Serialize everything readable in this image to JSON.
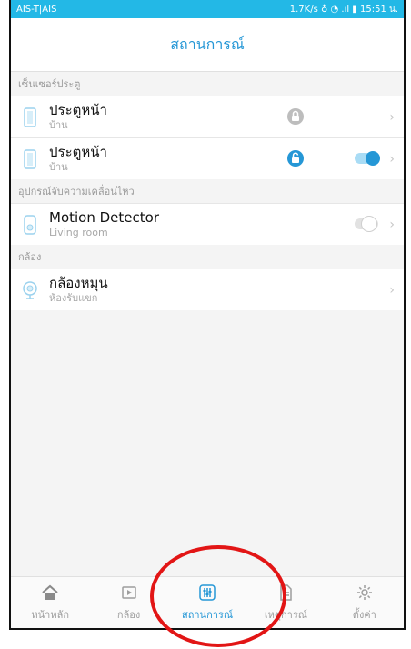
{
  "status_bar": {
    "carrier": "AIS-T|AIS",
    "right": "1.7K/s ♁ ◔ .ıl ▮ 15:51 น."
  },
  "header": {
    "title": "สถานการณ์"
  },
  "sections": [
    {
      "title": "เซ็นเซอร์ประตู",
      "items": [
        {
          "name": "ประตูหน้า",
          "location": "บ้าน",
          "lock": "locked"
        },
        {
          "name": "ประตูหน้า",
          "location": "บ้าน",
          "lock": "unlocked",
          "toggle": "on"
        }
      ]
    },
    {
      "title": "อุปกรณ์จับความเคลื่อนไหว",
      "items": [
        {
          "name": "Motion Detector",
          "location": "Living room",
          "toggle": "off"
        }
      ]
    },
    {
      "title": "กล้อง",
      "items": [
        {
          "name": "กล้องหมุน",
          "location": "ห้องรับแขก"
        }
      ]
    }
  ],
  "tabs": [
    {
      "label": "หน้าหลัก",
      "icon": "home-icon"
    },
    {
      "label": "กล้อง",
      "icon": "video-icon"
    },
    {
      "label": "สถานการณ์",
      "icon": "sliders-icon",
      "active": true
    },
    {
      "label": "เหตุการณ์",
      "icon": "document-icon"
    },
    {
      "label": "ตั้งค่า",
      "icon": "gear-icon"
    }
  ],
  "colors": {
    "accent": "#2597d6",
    "statusbar": "#23b8e6",
    "annotation": "#e21515"
  }
}
